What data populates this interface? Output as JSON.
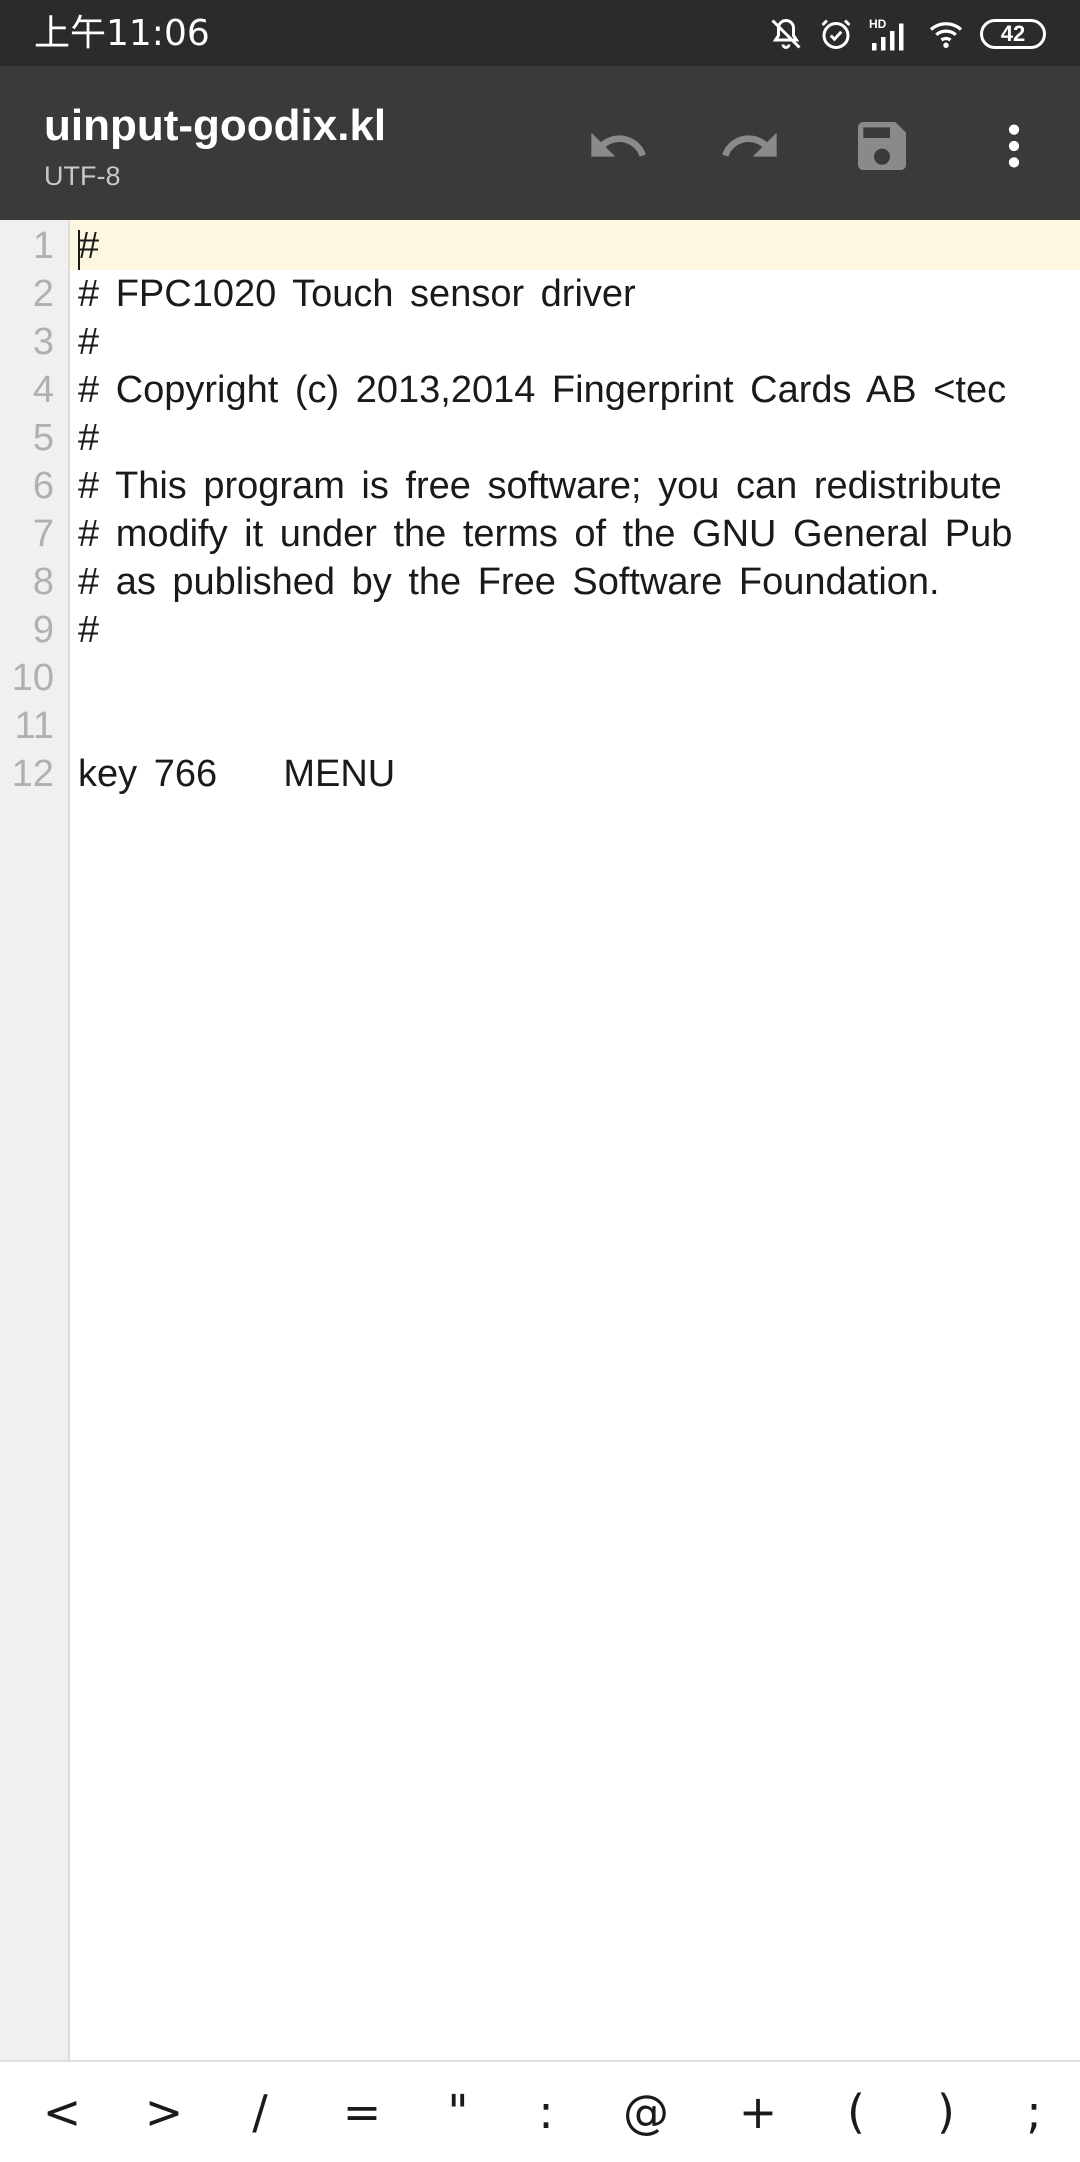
{
  "status_bar": {
    "time": "上午11:06",
    "battery": "42",
    "icons": [
      "mute-icon",
      "alarm-icon",
      "hd-signal-icon",
      "wifi-icon",
      "battery-icon"
    ]
  },
  "toolbar": {
    "title": "uinput-goodix.kl",
    "encoding": "UTF-8",
    "buttons": [
      "undo-icon",
      "redo-icon",
      "save-icon",
      "more-vert-icon"
    ]
  },
  "editor": {
    "lines": [
      {
        "num": "1",
        "text": "#"
      },
      {
        "num": "2",
        "text": "# FPC1020 Touch sensor driver"
      },
      {
        "num": "3",
        "text": "#"
      },
      {
        "num": "4",
        "text": "# Copyright (c) 2013,2014 Fingerprint Cards AB <tec"
      },
      {
        "num": "5",
        "text": "#"
      },
      {
        "num": "6",
        "text": "# This program is free software; you can redistribute"
      },
      {
        "num": "7",
        "text": "# modify it under the terms of the GNU General Pub"
      },
      {
        "num": "8",
        "text": "# as published by the Free Software Foundation."
      },
      {
        "num": "9",
        "text": "#"
      },
      {
        "num": "10",
        "text": ""
      },
      {
        "num": "11",
        "text": ""
      },
      {
        "num": "12",
        "text": "key 766    MENU"
      }
    ]
  },
  "symbol_bar": {
    "symbols": [
      "<",
      ">",
      "/",
      "=",
      "\"",
      ":",
      "@",
      "+",
      "(",
      ")",
      ";"
    ]
  },
  "colors": {
    "status_bg": "#2b2b2b",
    "toolbar_bg": "#3a3a3a",
    "current_line": "#fdf6e0",
    "gutter_bg": "#f0f0f0",
    "icon_gray": "#8a8a8a"
  }
}
